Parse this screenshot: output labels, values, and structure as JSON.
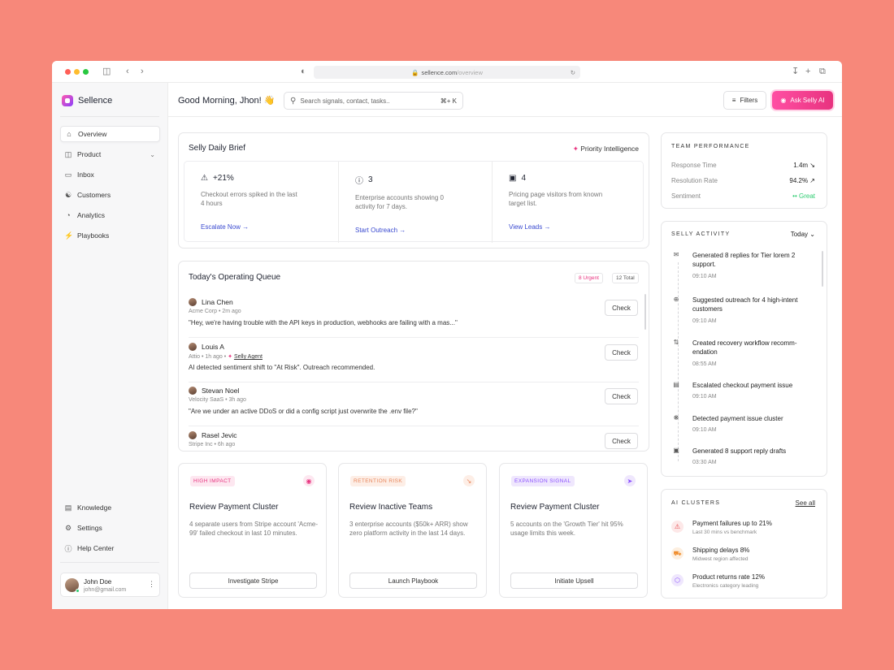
{
  "browser": {
    "url_host": "sellence.com",
    "url_path": "/overview"
  },
  "sidebar": {
    "brand": "Sellence",
    "nav": [
      {
        "label": "Overview",
        "icon": "home-icon"
      },
      {
        "label": "Product",
        "icon": "box-icon"
      },
      {
        "label": "Inbox",
        "icon": "inbox-icon"
      },
      {
        "label": "Customers",
        "icon": "users-icon"
      },
      {
        "label": "Analytics",
        "icon": "pie-chart-icon"
      },
      {
        "label": "Playbooks",
        "icon": "playbook-icon"
      }
    ],
    "bottom_nav": [
      {
        "label": "Knowledge",
        "icon": "book-icon"
      },
      {
        "label": "Settings",
        "icon": "gear-icon"
      },
      {
        "label": "Help Center",
        "icon": "help-icon"
      }
    ],
    "user": {
      "name": "John Doe",
      "email": "john@gmail.com"
    }
  },
  "header": {
    "greeting": "Good Morning, Jhon! 👋",
    "search_placeholder": "Search signals, contact, tasks..",
    "search_shortcut": "⌘+ K",
    "filters_label": "Filters",
    "ask_label": "Ask Selly AI"
  },
  "brief": {
    "title": "Selly Daily Brief",
    "badge": "Priority Intelligence",
    "items": [
      {
        "stat": "+21%",
        "desc": "Checkout errors spiked in the last 4 hours",
        "link": "Escalate Now →",
        "icon": "warning-icon"
      },
      {
        "stat": "3",
        "desc": "Enterprise accounts showing 0 activity for 7 days.",
        "link": "Start Outreach →",
        "icon": "alert-circle-icon"
      },
      {
        "stat": "4",
        "desc": "Pricing page visitors from known target list.",
        "link": "View Leads →",
        "icon": "visitor-icon"
      }
    ]
  },
  "queue": {
    "title": "Today's Operating Queue",
    "urgent": "8 Urgent",
    "total": "12 Total",
    "check_label": "Check",
    "items": [
      {
        "name": "Lina Chen",
        "meta": "Acme Corp • 2m ago",
        "agent": "",
        "text": "\"Hey, we're having trouble with the API keys in production, webhooks are failing with a mas...\""
      },
      {
        "name": "Louis A",
        "meta": "Attio • 1h ago •",
        "agent": "Selly Agent",
        "text": "AI detected sentiment shift to \"At Risk\". Outreach recommended."
      },
      {
        "name": "Stevan Noel",
        "meta": "Velocity SaaS • 3h ago",
        "agent": "",
        "text": "\"Are we under an active DDoS or did a config script just overwrite the .env file?\""
      },
      {
        "name": "Rasel Jevic",
        "meta": "Stripe Inc • 6h ago",
        "agent": "",
        "text": ""
      }
    ]
  },
  "actions": [
    {
      "tag": "HIGH IMPACT",
      "title": "Review Payment Cluster",
      "desc": "4 separate users from Stripe account 'Acme-99' failed checkout in last 10 minutes.",
      "button": "Investigate Stripe",
      "icon": "shield-icon"
    },
    {
      "tag": "RETENTION RISK",
      "title": "Review Inactive Teams",
      "desc": "3 enterprise accounts ($50k+ ARR) show zero platform activity in the last 14 days.",
      "button": "Launch Playbook",
      "icon": "trend-down-icon"
    },
    {
      "tag": "EXPANSION SIGNAL",
      "title": "Review Payment Cluster",
      "desc": "5 accounts on the 'Growth Tier' hit 95% usage limits this week.",
      "button": "Initiate Upsell",
      "icon": "rocket-icon"
    }
  ],
  "performance": {
    "title": "TEAM PERFORMANCE",
    "rows": [
      {
        "label": "Response Time",
        "value": "1.4m ↘"
      },
      {
        "label": "Resolution Rate",
        "value": "94.2% ↗"
      },
      {
        "label": "Sentiment",
        "value": "Great"
      }
    ]
  },
  "activity": {
    "title": "SELLY ACTIVITY",
    "filter": "Today",
    "items": [
      {
        "text": "Generated 8 replies for Tier lorem 2 support.",
        "time": "09:10 AM",
        "icon": "mail-icon"
      },
      {
        "text": "Suggested outreach for 4 high-intent customers",
        "time": "09:10 AM",
        "icon": "target-icon"
      },
      {
        "text": "Created recovery workflow recomm-endation",
        "time": "08:55 AM",
        "icon": "workflow-icon"
      },
      {
        "text": "Escalated checkout payment issue",
        "time": "09:10 AM",
        "icon": "card-icon"
      },
      {
        "text": "Detected payment issue cluster",
        "time": "09:10 AM",
        "icon": "cluster-icon"
      },
      {
        "text": "Generated 8 support reply drafts",
        "time": "03:30 AM",
        "icon": "chat-icon"
      }
    ]
  },
  "clusters": {
    "title": "AI CLUSTERS",
    "see_all": "See all",
    "items": [
      {
        "title": "Payment failures up to 21%",
        "sub": "Last 30 mins vs benchmark",
        "icon": "warning-icon",
        "color": "#e5484d"
      },
      {
        "title": "Shipping delays 8%",
        "sub": "Midwest region affected",
        "icon": "truck-icon",
        "color": "#f08c2b"
      },
      {
        "title": "Product returns rate 12%",
        "sub": "Electronics category leading",
        "icon": "package-icon",
        "color": "#8a4fff"
      }
    ]
  },
  "colors": {
    "accent": "#e8337f",
    "link": "#3a4ad0",
    "great": "#2ecc71"
  }
}
